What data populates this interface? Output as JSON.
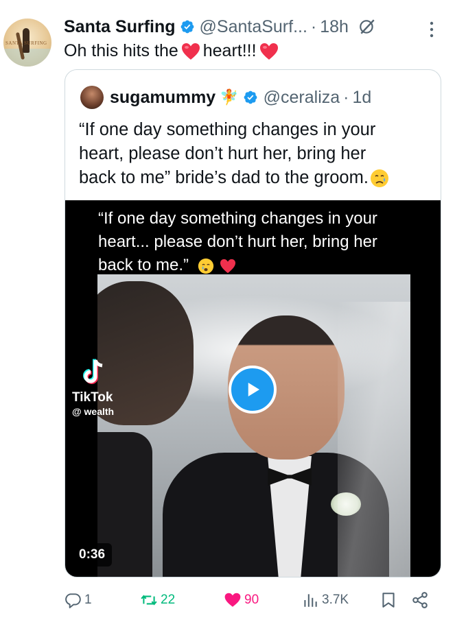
{
  "post": {
    "display_name": "Santa Surfing",
    "handle": "@SantaSurf...",
    "separator": "·",
    "time": "18h",
    "text_part1": "Oh this hits the",
    "text_part2": "heart!!!",
    "avatar_text": "SANTA SURFING"
  },
  "quote": {
    "display_name": "sugamummy",
    "emoji": "🧚",
    "handle": "@ceraliza",
    "separator": "·",
    "time": "1d",
    "text_lines": [
      "“If one day something changes in your",
      "heart, please don’t hurt her, bring her",
      "back to me” bride’s dad to the groom."
    ]
  },
  "video": {
    "caption_lines": [
      "“If one day something changes in your",
      "heart... please don’t hurt her, bring her",
      "back to me.”"
    ],
    "watermark_name": "TikTok",
    "watermark_user": "@ wealth",
    "duration": "0:36"
  },
  "actions": {
    "replies": "1",
    "reposts": "22",
    "likes": "90",
    "views": "3.7K"
  },
  "colors": {
    "text": "#0f1419",
    "secondary": "#536471",
    "accent": "#1d9bf0",
    "repost": "#00ba7c",
    "like": "#f91880",
    "border": "#cfd9de"
  }
}
